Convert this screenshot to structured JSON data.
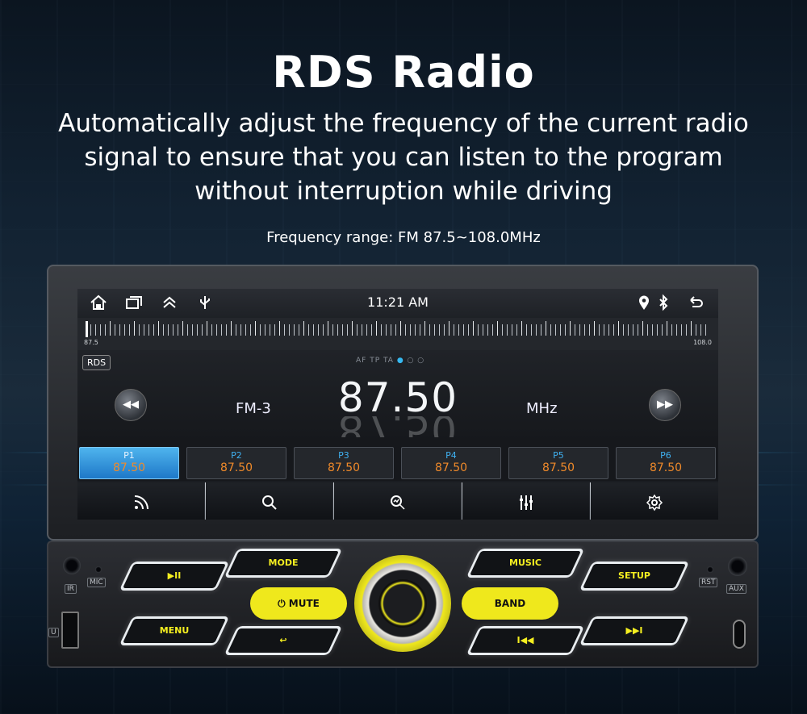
{
  "header": {
    "title": "RDS Radio",
    "subtitle": "Automatically adjust the frequency of the current radio signal to ensure that you can listen to the program without interruption while driving",
    "freq_range": "Frequency range: FM 87.5~108.0MHz"
  },
  "statusbar": {
    "time": "11:21 AM",
    "icons": [
      "home-icon",
      "recent-apps-icon",
      "expand-icon",
      "usb-icon",
      "location-icon",
      "bluetooth-icon",
      "back-icon"
    ]
  },
  "scale": {
    "min": "87.5",
    "max": "108.0",
    "needle_fraction": 0
  },
  "tuner": {
    "rds_label": "RDS",
    "flags": "AF TP TA",
    "band": "FM-3",
    "frequency": "87.50",
    "unit": "MHz"
  },
  "presets": [
    {
      "label": "P1",
      "value": "87.50",
      "active": true
    },
    {
      "label": "P2",
      "value": "87.50",
      "active": false
    },
    {
      "label": "P3",
      "value": "87.50",
      "active": false
    },
    {
      "label": "P4",
      "value": "87.50",
      "active": false
    },
    {
      "label": "P5",
      "value": "87.50",
      "active": false
    },
    {
      "label": "P6",
      "value": "87.50",
      "active": false
    }
  ],
  "toolbar": {
    "icons": [
      "signal-icon",
      "search-icon",
      "scan-icon",
      "equalizer-icon",
      "settings-icon"
    ]
  },
  "panel": {
    "ir": "IR",
    "mic": "MIC",
    "rst": "RST",
    "aux": "AUX",
    "usb": "U",
    "play_pause": "▶II",
    "mode": "MODE",
    "mute": "MUTE",
    "menu": "MENU",
    "music": "MUSIC",
    "setup": "SETUP",
    "band": "BAND",
    "prev": "I◀◀",
    "next": "▶▶I"
  },
  "colors": {
    "accent_yellow": "#efe81c",
    "preset_value": "#f08a2a",
    "preset_label": "#3fb0f0"
  }
}
